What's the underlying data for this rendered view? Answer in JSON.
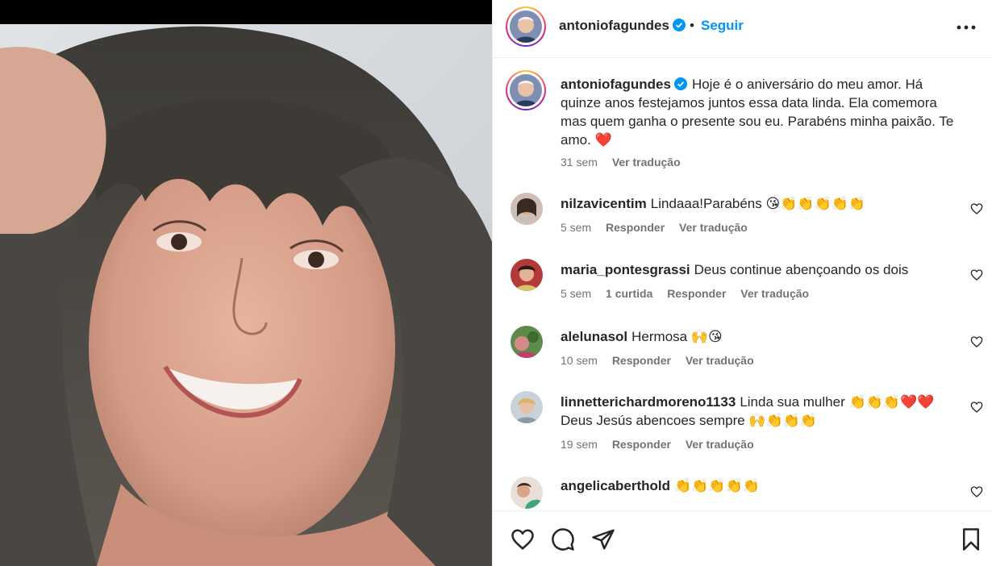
{
  "post": {
    "author": "antoniofagundes",
    "follow_label": "Seguir",
    "separator": "•",
    "caption": "Hoje é o aniversário do meu amor. Há quinze anos festejamos juntos essa data linda. Ela comemora mas quem ganha o presente sou eu. Parabéns minha paixão. Te amo. ❤️",
    "caption_time": "31 sem",
    "caption_translate": "Ver tradução"
  },
  "comments": [
    {
      "user": "nilzavicentim",
      "text": "Lindaaa!Parabéns 😘👏👏👏👏👏",
      "time": "5 sem",
      "likes": "",
      "reply": "Responder",
      "translate": "Ver tradução"
    },
    {
      "user": "maria_pontesgrassi",
      "text": "Deus continue abençoando os dois",
      "time": "5 sem",
      "likes": "1 curtida",
      "reply": "Responder",
      "translate": "Ver tradução"
    },
    {
      "user": "alelunasol",
      "text": "Hermosa 🙌😘",
      "time": "10 sem",
      "likes": "",
      "reply": "Responder",
      "translate": "Ver tradução"
    },
    {
      "user": "linnetterichardmoreno1133",
      "text": "Linda sua mulher 👏👏👏❤️❤️ Deus Jesús abencoes sempre 🙌👏👏👏",
      "time": "19 sem",
      "likes": "",
      "reply": "Responder",
      "translate": "Ver tradução"
    },
    {
      "user": "angelicaberthold",
      "text": "👏👏👏👏👏",
      "time": "",
      "likes": "",
      "reply": "",
      "translate": ""
    }
  ],
  "icons": {
    "like": "heart-outline-icon",
    "comment": "comment-bubble-icon",
    "share": "paper-plane-icon",
    "save": "bookmark-icon",
    "more": "ellipsis-icon",
    "verified": "verified-badge-icon"
  },
  "colors": {
    "link_blue": "#0095f6",
    "text": "#262626",
    "muted": "#737373",
    "border": "#efefef"
  }
}
